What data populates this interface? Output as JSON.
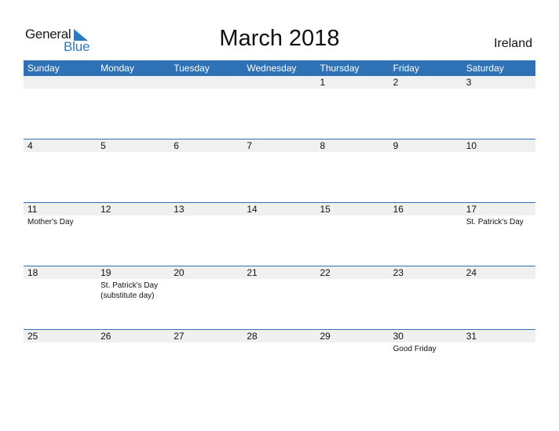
{
  "logo": {
    "word1": "General",
    "word2": "Blue",
    "accent": "#2a7ac0"
  },
  "title": "March 2018",
  "country": "Ireland",
  "header_color": "#2e72b5",
  "weekdays": [
    "Sunday",
    "Monday",
    "Tuesday",
    "Wednesday",
    "Thursday",
    "Friday",
    "Saturday"
  ],
  "weeks": [
    {
      "days": [
        {
          "n": "",
          "e": ""
        },
        {
          "n": "",
          "e": ""
        },
        {
          "n": "",
          "e": ""
        },
        {
          "n": "",
          "e": ""
        },
        {
          "n": "1",
          "e": ""
        },
        {
          "n": "2",
          "e": ""
        },
        {
          "n": "3",
          "e": ""
        }
      ]
    },
    {
      "days": [
        {
          "n": "4",
          "e": ""
        },
        {
          "n": "5",
          "e": ""
        },
        {
          "n": "6",
          "e": ""
        },
        {
          "n": "7",
          "e": ""
        },
        {
          "n": "8",
          "e": ""
        },
        {
          "n": "9",
          "e": ""
        },
        {
          "n": "10",
          "e": ""
        }
      ]
    },
    {
      "days": [
        {
          "n": "11",
          "e": "Mother's Day"
        },
        {
          "n": "12",
          "e": ""
        },
        {
          "n": "13",
          "e": ""
        },
        {
          "n": "14",
          "e": ""
        },
        {
          "n": "15",
          "e": ""
        },
        {
          "n": "16",
          "e": ""
        },
        {
          "n": "17",
          "e": "St. Patrick's Day"
        }
      ]
    },
    {
      "days": [
        {
          "n": "18",
          "e": ""
        },
        {
          "n": "19",
          "e": "St. Patrick's Day (substitute day)"
        },
        {
          "n": "20",
          "e": ""
        },
        {
          "n": "21",
          "e": ""
        },
        {
          "n": "22",
          "e": ""
        },
        {
          "n": "23",
          "e": ""
        },
        {
          "n": "24",
          "e": ""
        }
      ]
    },
    {
      "days": [
        {
          "n": "25",
          "e": ""
        },
        {
          "n": "26",
          "e": ""
        },
        {
          "n": "27",
          "e": ""
        },
        {
          "n": "28",
          "e": ""
        },
        {
          "n": "29",
          "e": ""
        },
        {
          "n": "30",
          "e": "Good Friday"
        },
        {
          "n": "31",
          "e": ""
        }
      ]
    }
  ]
}
